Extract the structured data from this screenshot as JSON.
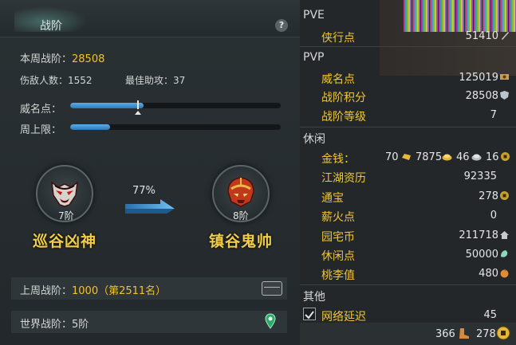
{
  "left_panel": {
    "title": "战阶",
    "help": "?",
    "weekly": {
      "label": "本周战阶：",
      "value": "28508"
    },
    "kills": "伤敌人数：1552",
    "assists": "最佳助攻：37",
    "prestige_label": "威名点：",
    "weekly_cap_label": "周上限：",
    "prestige_progress": 0.35,
    "weekly_cap_progress": 0.19,
    "current_rank": {
      "tier": "7阶",
      "name": "巡谷凶神"
    },
    "next_rank": {
      "tier": "8阶",
      "name": "镇谷鬼帅"
    },
    "progress_percent": "77%",
    "last_week": {
      "label": "上周战阶：",
      "value": "1000（第2511名）"
    },
    "world_rank": "世界战阶：5阶"
  },
  "right_panel": {
    "sections": {
      "pve": "PVE",
      "pvp": "PVP",
      "leisure": "休闲",
      "other": "其他"
    },
    "pve_rows": [
      {
        "label": "侠行点",
        "value": "51410"
      }
    ],
    "pvp_rows": [
      {
        "label": "威名点",
        "value": "125019"
      },
      {
        "label": "战阶积分",
        "value": "28508"
      },
      {
        "label": "战阶等级",
        "value": "7"
      }
    ],
    "money": {
      "label": "金钱：",
      "v1": "70",
      "v2": "7875",
      "v3": "46",
      "v4": "16"
    },
    "leisure_rows": [
      {
        "label": "江湖资历",
        "value": "92335"
      },
      {
        "label": "通宝",
        "value": "278"
      },
      {
        "label": "薪火点",
        "value": "0"
      },
      {
        "label": "园宅币",
        "value": "211718"
      },
      {
        "label": "休闲点",
        "value": "50000"
      },
      {
        "label": "桃李值",
        "value": "480"
      }
    ],
    "other_rows": [
      {
        "label": "网络延迟",
        "value": "45"
      }
    ],
    "footer": {
      "left_value": "366",
      "right_value": "278"
    },
    "colors": {
      "label": "#f1c533",
      "value": "#e6e6e6",
      "accent_blue": "#3a8ad0"
    }
  }
}
